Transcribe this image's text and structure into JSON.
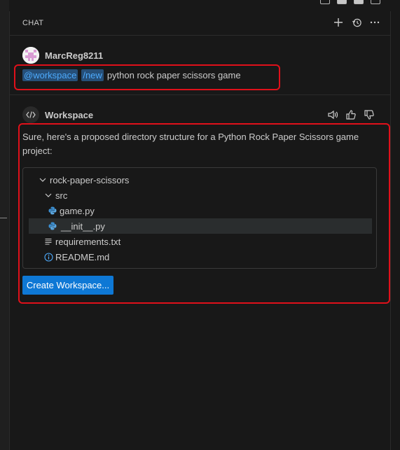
{
  "panel": {
    "title": "CHAT",
    "actions": [
      {
        "name": "new-chat-icon"
      },
      {
        "name": "history-icon"
      },
      {
        "name": "more-icon"
      }
    ]
  },
  "user_message": {
    "username": "MarcReg8211",
    "agent_tag": "@workspace",
    "command_tag": "/new",
    "text": "python rock paper scissors game"
  },
  "response": {
    "agent_name": "Workspace",
    "intro": "Sure, here's a proposed directory structure for a Python Rock Paper Scissors game project:",
    "tree": [
      {
        "label": "rock-paper-scissors",
        "icon": "chevron-down-icon",
        "depth": 0
      },
      {
        "label": "src",
        "icon": "chevron-down-icon",
        "depth": 1
      },
      {
        "label": "game.py",
        "icon": "python-file-icon",
        "depth": 2
      },
      {
        "label": "__init__.py",
        "icon": "python-file-icon",
        "depth": 2,
        "selected": true
      },
      {
        "label": "requirements.txt",
        "icon": "text-file-icon",
        "depth": 1
      },
      {
        "label": "README.md",
        "icon": "info-file-icon",
        "depth": 1
      }
    ],
    "create_button": "Create Workspace..."
  },
  "colors": {
    "accent_blue": "#0e78d5",
    "tag_text": "#4daafc",
    "tag_bg": "#264f78",
    "highlight_red": "#e0101a",
    "python_blue": "#3b8ed0"
  }
}
